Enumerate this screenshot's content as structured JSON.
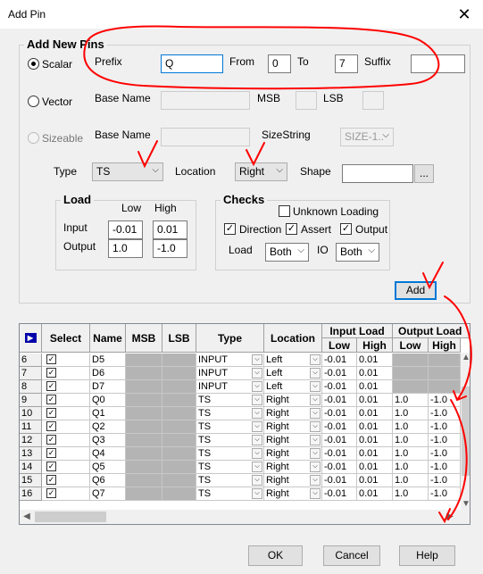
{
  "window": {
    "title": "Add Pin",
    "close_glyph": "✕"
  },
  "add_new_pins": {
    "legend": "Add New Pins",
    "scalar": {
      "label": "Scalar",
      "selected": true
    },
    "vector": {
      "label": "Vector",
      "selected": false
    },
    "sizeable": {
      "label": "Sizeable",
      "enabled": false
    },
    "prefix_label": "Prefix",
    "prefix_value": "Q",
    "from_label": "From",
    "from_value": "0",
    "to_label": "To",
    "to_value": "7",
    "suffix_label": "Suffix",
    "suffix_value": "",
    "vector_base_name_label": "Base Name",
    "vector_base_name_value": "",
    "msb_label": "MSB",
    "msb_value": "",
    "lsb_label": "LSB",
    "lsb_value": "",
    "sizeable_base_name_label": "Base Name",
    "sizeable_base_name_value": "",
    "sizestring_label": "SizeString",
    "sizestring_value": "SIZE-1..",
    "type_label": "Type",
    "type_value": "TS",
    "location_label": "Location",
    "location_value": "Right",
    "shape_label": "Shape",
    "shape_value": "",
    "shape_browse": "...",
    "load": {
      "legend": "Load",
      "low_header": "Low",
      "high_header": "High",
      "input_label": "Input",
      "input_low": "-0.01",
      "input_high": "0.01",
      "output_label": "Output",
      "output_low": "1.0",
      "output_high": "-1.0"
    },
    "checks": {
      "legend": "Checks",
      "unknown_loading": {
        "label": "Unknown Loading",
        "checked": false
      },
      "direction": {
        "label": "Direction",
        "checked": true
      },
      "assert": {
        "label": "Assert",
        "checked": true
      },
      "output": {
        "label": "Output",
        "checked": true
      },
      "load_label": "Load",
      "load_value": "Both",
      "io_label": "IO",
      "io_value": "Both"
    },
    "add_button": "Add"
  },
  "grid": {
    "columns": {
      "select": "Select",
      "name": "Name",
      "msb": "MSB",
      "lsb": "LSB",
      "type": "Type",
      "location": "Location",
      "input_load": "Input Load",
      "output_load": "Output Load",
      "low": "Low",
      "high": "High"
    },
    "rows": [
      {
        "num": "6",
        "name": "D5",
        "type": "INPUT",
        "location": "Left",
        "in_low": "-0.01",
        "in_high": "0.01",
        "out_low": "",
        "out_high": ""
      },
      {
        "num": "7",
        "name": "D6",
        "type": "INPUT",
        "location": "Left",
        "in_low": "-0.01",
        "in_high": "0.01",
        "out_low": "",
        "out_high": ""
      },
      {
        "num": "8",
        "name": "D7",
        "type": "INPUT",
        "location": "Left",
        "in_low": "-0.01",
        "in_high": "0.01",
        "out_low": "",
        "out_high": ""
      },
      {
        "num": "9",
        "name": "Q0",
        "type": "TS",
        "location": "Right",
        "in_low": "-0.01",
        "in_high": "0.01",
        "out_low": "1.0",
        "out_high": "-1.0"
      },
      {
        "num": "10",
        "name": "Q1",
        "type": "TS",
        "location": "Right",
        "in_low": "-0.01",
        "in_high": "0.01",
        "out_low": "1.0",
        "out_high": "-1.0"
      },
      {
        "num": "11",
        "name": "Q2",
        "type": "TS",
        "location": "Right",
        "in_low": "-0.01",
        "in_high": "0.01",
        "out_low": "1.0",
        "out_high": "-1.0"
      },
      {
        "num": "12",
        "name": "Q3",
        "type": "TS",
        "location": "Right",
        "in_low": "-0.01",
        "in_high": "0.01",
        "out_low": "1.0",
        "out_high": "-1.0"
      },
      {
        "num": "13",
        "name": "Q4",
        "type": "TS",
        "location": "Right",
        "in_low": "-0.01",
        "in_high": "0.01",
        "out_low": "1.0",
        "out_high": "-1.0"
      },
      {
        "num": "14",
        "name": "Q5",
        "type": "TS",
        "location": "Right",
        "in_low": "-0.01",
        "in_high": "0.01",
        "out_low": "1.0",
        "out_high": "-1.0"
      },
      {
        "num": "15",
        "name": "Q6",
        "type": "TS",
        "location": "Right",
        "in_low": "-0.01",
        "in_high": "0.01",
        "out_low": "1.0",
        "out_high": "-1.0"
      },
      {
        "num": "16",
        "name": "Q7",
        "type": "TS",
        "location": "Right",
        "in_low": "-0.01",
        "in_high": "0.01",
        "out_low": "1.0",
        "out_high": "-1.0"
      }
    ]
  },
  "buttons": {
    "ok": "OK",
    "cancel": "Cancel",
    "help": "Help"
  },
  "colors": {
    "accent": "#0078d7",
    "annotation": "#ff0000",
    "gray_cell": "#b4b4b4"
  }
}
